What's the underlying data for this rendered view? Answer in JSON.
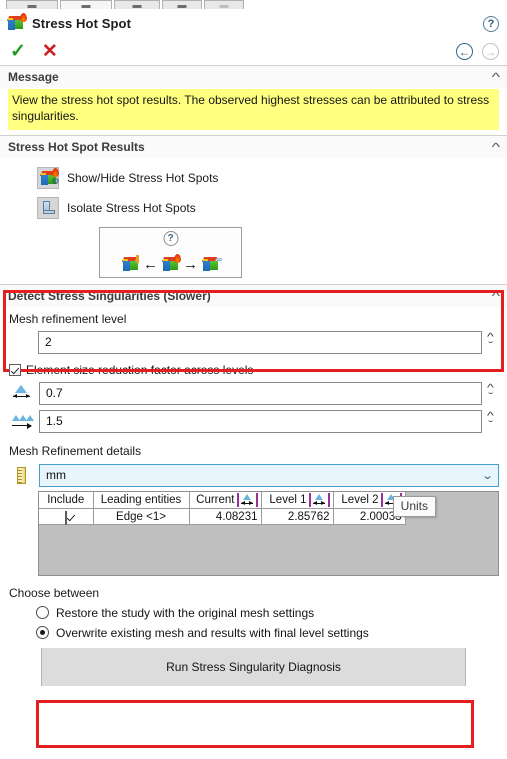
{
  "tabstrip": {
    "tabs": [
      {
        "name": "tab-1",
        "state": "normal"
      },
      {
        "name": "tab-2",
        "state": "selected"
      },
      {
        "name": "tab-3",
        "state": "normal"
      },
      {
        "name": "tab-4",
        "state": "normal"
      },
      {
        "name": "tab-5",
        "state": "dim"
      }
    ]
  },
  "header": {
    "title": "Stress Hot Spot",
    "title_icon": "stress-hot-spot-icon",
    "help_label": "?",
    "ok_label": "✓",
    "cancel_label": "✕",
    "back_label": "←",
    "forward_label": "→"
  },
  "message_section": {
    "header": "Message",
    "collapse_icon": "chevron-up-icon",
    "text": "View the stress hot spot results. The observed highest stresses can be attributed to stress singularities."
  },
  "results_section": {
    "header": "Stress Hot Spot Results",
    "collapse_icon": "chevron-up-icon",
    "show_hide_label": "Show/Hide Stress Hot Spots",
    "isolate_label": "Isolate Stress Hot Spots",
    "diagram": {
      "help_label": "?",
      "left_arrow": "←",
      "right_arrow": "→"
    }
  },
  "detect_section": {
    "header": "Detect Stress Singularities (Slower)",
    "collapse_icon": "chevron-up-icon",
    "mesh_level_label": "Mesh refinement level",
    "mesh_level_value": "2",
    "highlight_color": "#e61e1e"
  },
  "reduction": {
    "checkbox_label": "Element size reduction factor across levels",
    "checkbox_checked": true,
    "field1_value": "0.7",
    "field1_icon": "element-size-icon",
    "field2_value": "1.5",
    "field2_icon": "layers-growth-icon"
  },
  "mesh_details": {
    "label": "Mesh Refinement details",
    "units_icon": "ruler-icon",
    "units_value": "mm",
    "dropdown_icon": "chevron-down-icon",
    "tooltip": "Units",
    "columns": [
      "Include",
      "Leading entities",
      "Current",
      "Level 1",
      "Level 2"
    ],
    "rows": [
      {
        "include": true,
        "entity": "Edge <1>",
        "current": "4.08231",
        "level1": "2.85762",
        "level2": "2.00033"
      }
    ]
  },
  "choose": {
    "label": "Choose between",
    "options": [
      {
        "label": "Restore the study with the original mesh settings",
        "selected": false
      },
      {
        "label": "Overwrite existing mesh and results with final level settings",
        "selected": true
      }
    ]
  },
  "run": {
    "label": "Run Stress Singularity Diagnosis",
    "highlight_color": "#e61e1e"
  }
}
